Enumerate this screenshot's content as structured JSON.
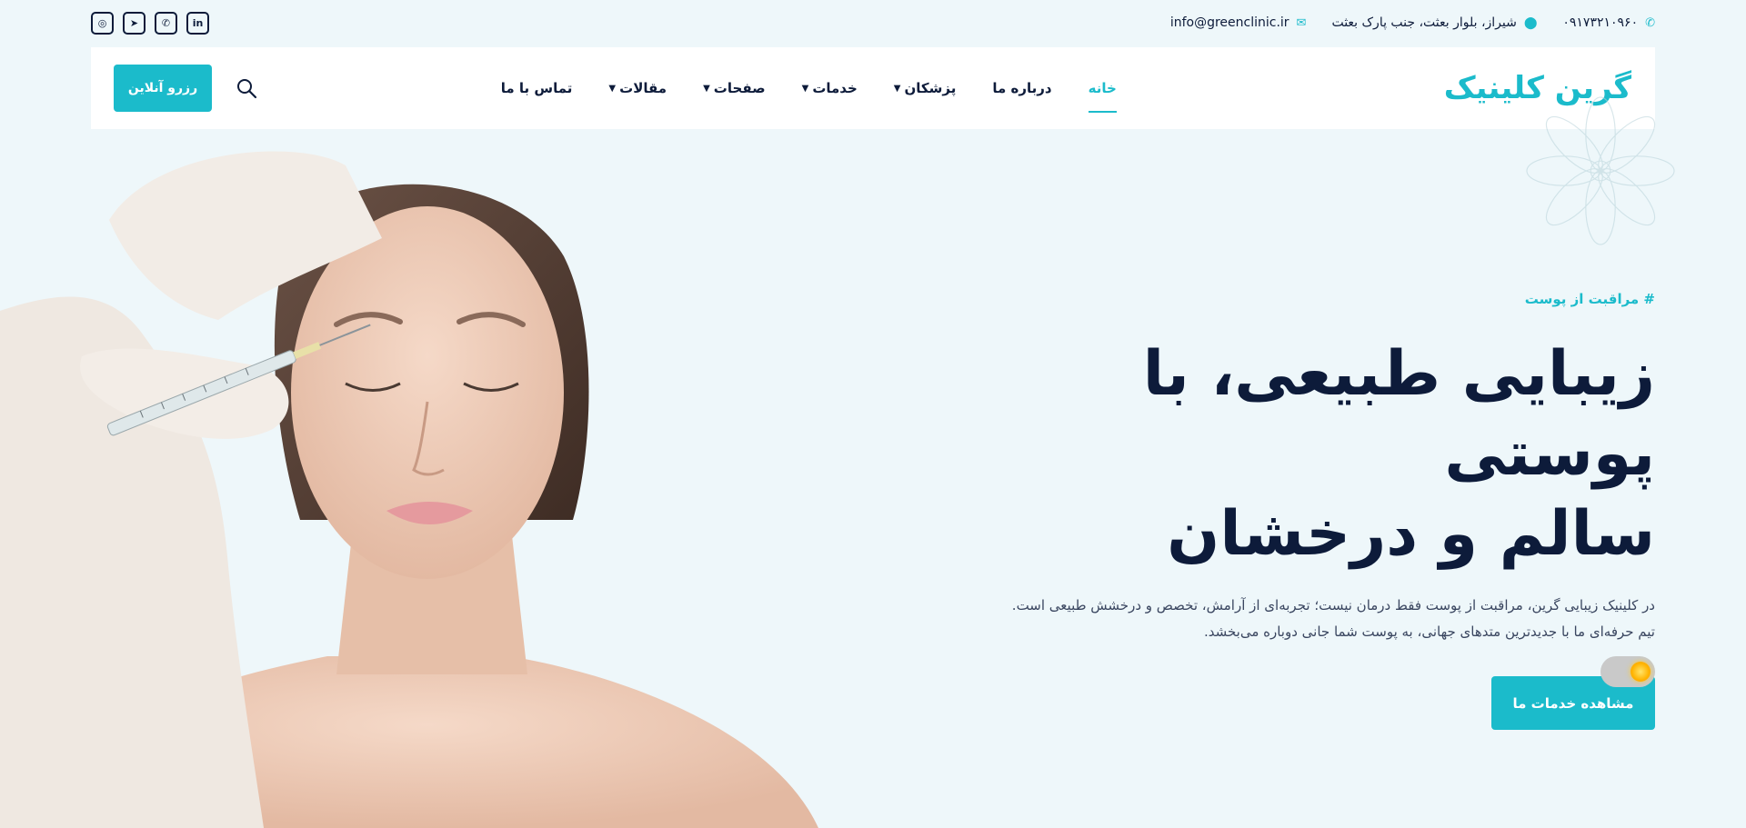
{
  "topbar": {
    "phone": "۰۹۱۷۳۲۱۰۹۶۰",
    "address": "شیراز، بلوار بعثت، جنب پارک بعثت",
    "email": "info@greenclinic.ir",
    "socials": [
      {
        "icon": "instagram-icon",
        "glyph": "◎"
      },
      {
        "icon": "telegram-icon",
        "glyph": "➤"
      },
      {
        "icon": "whatsapp-icon",
        "glyph": "✆"
      },
      {
        "icon": "linkedin-icon",
        "glyph": "in"
      }
    ]
  },
  "header": {
    "logo": "گرین کلینیک",
    "nav": [
      {
        "label": "خانه",
        "active": true,
        "dropdown": false
      },
      {
        "label": "درباره ما",
        "active": false,
        "dropdown": false
      },
      {
        "label": "پزشکان",
        "active": false,
        "dropdown": true
      },
      {
        "label": "خدمات",
        "active": false,
        "dropdown": true
      },
      {
        "label": "صفحات",
        "active": false,
        "dropdown": true
      },
      {
        "label": "مقالات",
        "active": false,
        "dropdown": true
      },
      {
        "label": "تماس با ما",
        "active": false,
        "dropdown": false
      }
    ],
    "reserve_label": "رزرو آنلاین"
  },
  "hero": {
    "eyebrow": "# مراقبت از پوست",
    "headline_line1": "زیبایی طبیعی، با پوستی",
    "headline_line2": "سالم و درخشان",
    "desc_line1": "در کلینیک زیبایی گرین، مراقبت از پوست فقط درمان نیست؛ تجربه‌ای از آرامش، تخصص و درخشش طبیعی است.",
    "desc_line2": "تیم حرفه‌ای ما با جدیدترین متدهای جهانی، به پوست شما جانی دوباره می‌بخشد.",
    "cta_label": "مشاهده خدمات ما"
  },
  "colors": {
    "accent": "#1bbbcb",
    "text_dark": "#0d1b3a",
    "background": "#eef7fa"
  }
}
